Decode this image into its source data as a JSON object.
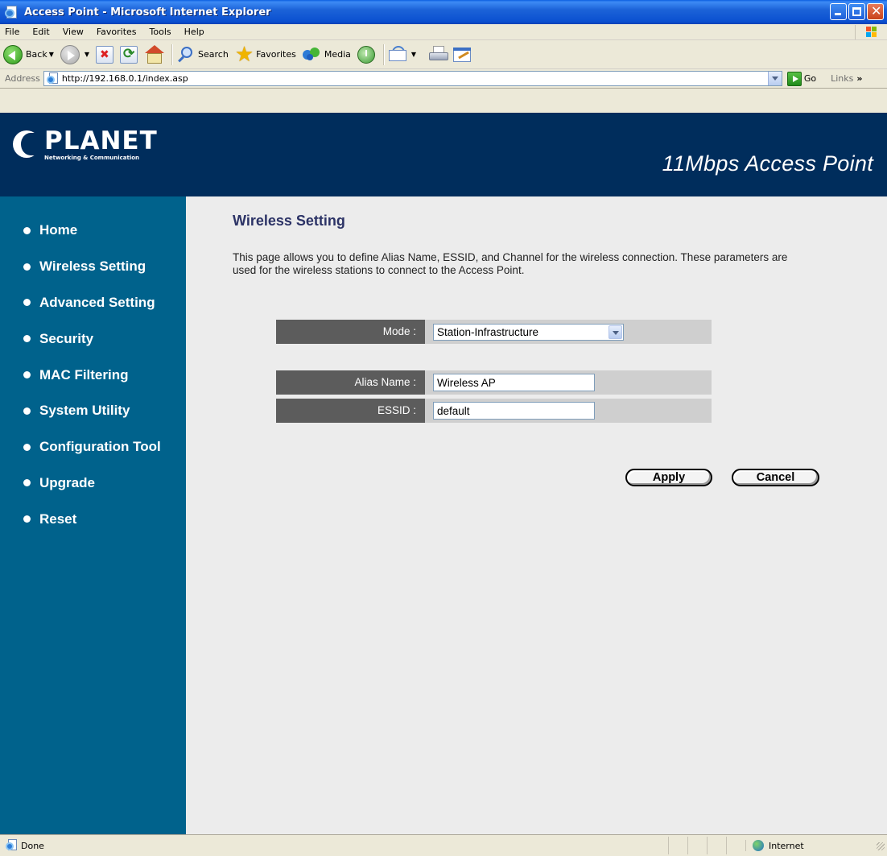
{
  "window": {
    "title": "Access Point - Microsoft Internet Explorer"
  },
  "menu": [
    "File",
    "Edit",
    "View",
    "Favorites",
    "Tools",
    "Help"
  ],
  "toolbar": {
    "back": "Back",
    "search": "Search",
    "favorites": "Favorites",
    "media": "Media"
  },
  "address": {
    "label": "Address",
    "url": "http://192.168.0.1/index.asp",
    "go": "Go",
    "links": "Links"
  },
  "header": {
    "brand": "PLANET",
    "tagline": "Networking & Communication",
    "product": "11Mbps Access Point"
  },
  "nav": [
    "Home",
    "Wireless Setting",
    "Advanced Setting",
    "Security",
    "MAC Filtering",
    "System Utility",
    "Configuration Tool",
    "Upgrade",
    "Reset"
  ],
  "content": {
    "title": "Wireless Setting",
    "description": "This page allows you to define Alias Name, ESSID, and Channel for the wireless connection. These parameters are used for the wireless stations to connect to the Access Point."
  },
  "form": {
    "mode_label": "Mode :",
    "mode_value": "Station-Infrastructure",
    "alias_label": "Alias Name :",
    "alias_value": "Wireless AP",
    "essid_label": "ESSID :",
    "essid_value": "default",
    "apply": "Apply",
    "cancel": "Cancel"
  },
  "status": {
    "text": "Done",
    "zone": "Internet"
  },
  "colors": {
    "banner": "#002d5c",
    "sidebar": "#00628c",
    "title_text": "#2c3366",
    "label_bg": "#5c5c5c",
    "field_bg": "#cfcfcf"
  }
}
